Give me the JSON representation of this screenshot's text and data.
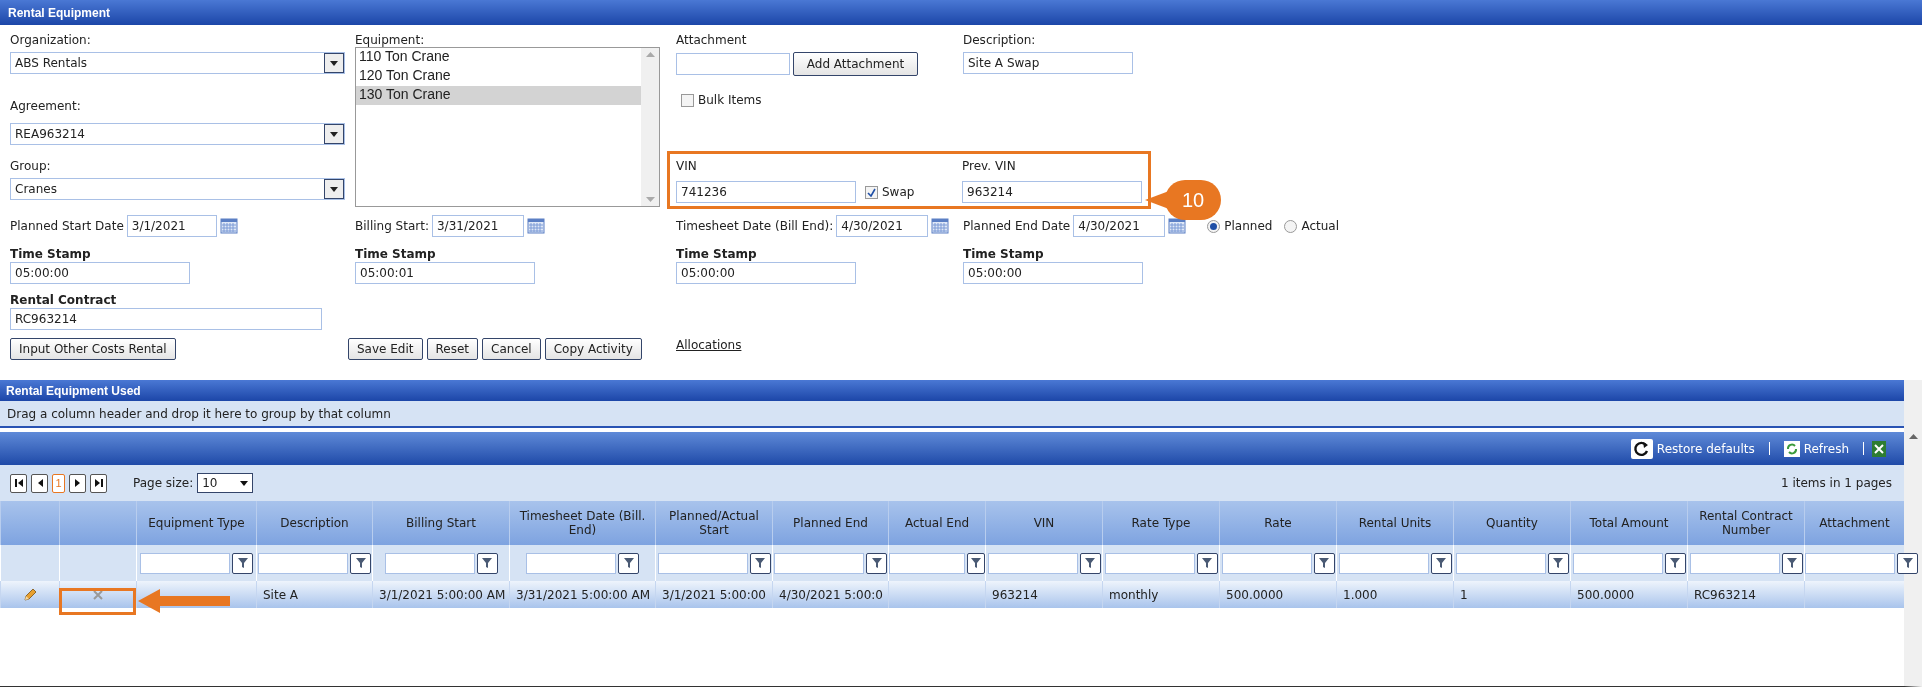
{
  "panel": {
    "title": "Rental Equipment"
  },
  "form": {
    "organization": {
      "label": "Organization:",
      "value": "ABS Rentals"
    },
    "agreement": {
      "label": "Agreement:",
      "value": "REA963214"
    },
    "group": {
      "label": "Group:",
      "value": "Cranes"
    },
    "equipment": {
      "label": "Equipment:",
      "items": [
        {
          "text": "110 Ton Crane",
          "selected": false
        },
        {
          "text": "120 Ton Crane",
          "selected": false
        },
        {
          "text": "130 Ton Crane",
          "selected": true
        }
      ]
    },
    "attachment": {
      "label": "Attachment",
      "button": "Add Attachment"
    },
    "bulk_items": {
      "label": "Bulk Items",
      "checked": false
    },
    "description": {
      "label": "Description:",
      "value": "Site A Swap"
    },
    "vin": {
      "label": "VIN",
      "value": "741236"
    },
    "swap": {
      "label": "Swap",
      "checked": true
    },
    "prev_vin": {
      "label": "Prev. VIN",
      "value": "963214"
    },
    "callout": "10",
    "dates": [
      {
        "label": "Planned Start Date",
        "value": "3/1/2021",
        "stamp_label": "Time Stamp",
        "stamp": "05:00:00"
      },
      {
        "label": "Billing Start:",
        "value": "3/31/2021",
        "stamp_label": "Time Stamp",
        "stamp": "05:00:01"
      },
      {
        "label": "Timesheet Date (Bill End):",
        "value": "4/30/2021",
        "stamp_label": "Time Stamp",
        "stamp": "05:00:00"
      },
      {
        "label": "Planned End Date",
        "value": "4/30/2021",
        "stamp_label": "Time Stamp",
        "stamp": "05:00:00"
      }
    ],
    "mode": [
      {
        "label": "Planned",
        "selected": true
      },
      {
        "label": "Actual",
        "selected": false
      }
    ],
    "rental_contract": {
      "label": "Rental Contract",
      "value": "RC963214"
    },
    "other_costs_button": "Input Other Costs Rental",
    "actions": [
      "Save Edit",
      "Reset",
      "Cancel",
      "Copy Activity"
    ],
    "allocations_link": "Allocations"
  },
  "grid": {
    "title": "Rental Equipment Used",
    "group_hint": "Drag a column header and drop it here to group by that column",
    "toolbar": [
      "Restore defaults",
      "Refresh"
    ],
    "pager": {
      "pages": [
        {
          "label": "1",
          "selected": true
        }
      ],
      "page_size_label": "Page size:",
      "page_size": "10",
      "summary": "1 items in 1 pages"
    },
    "columns": [
      "Equipment Type",
      "Description",
      "Billing Start",
      "Timesheet Date (Bill. End)",
      "Planned/Actual Start",
      "Planned End",
      "Actual End",
      "VIN",
      "Rate Type",
      "Rate",
      "Rental Units",
      "Quantity",
      "Total Amount",
      "Rental Contract Number",
      "Attachment"
    ],
    "rows": [
      {
        "delete_highlighted": true,
        "cells": [
          null,
          "Site A",
          "3/1/2021 5:00:00 AM",
          "3/31/2021 5:00:00 AM",
          "3/1/2021 5:00:00",
          "4/30/2021 5:00:0",
          null,
          "963214",
          "monthly",
          "500.0000",
          "1.000",
          "1",
          "500.0000",
          "RC963214",
          null
        ]
      }
    ]
  }
}
